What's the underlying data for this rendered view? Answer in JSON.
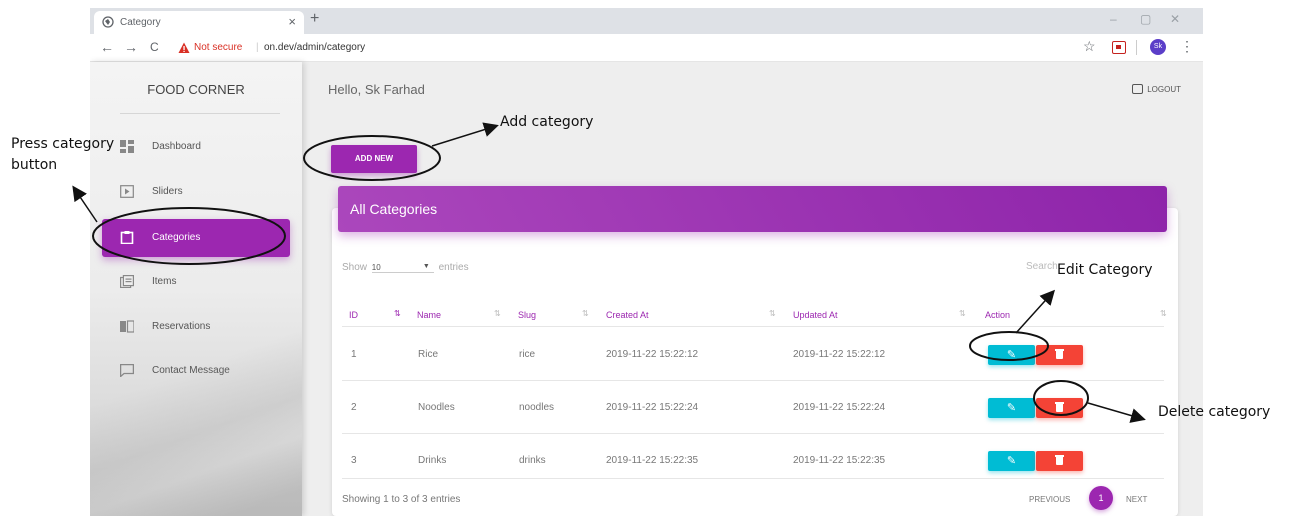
{
  "browser": {
    "tab_title": "Category",
    "tab_close": "×",
    "new_tab": "+",
    "not_secure": "Not secure",
    "url": "on.dev/admin/category",
    "back": "←",
    "forward": "→",
    "reload": "C",
    "star": "☆",
    "avatar": "Sk",
    "menu": "⋮",
    "minimize": "–",
    "restore": "▢",
    "close": "✕"
  },
  "sidebar": {
    "brand": "FOOD CORNER",
    "items": [
      {
        "label": "Dashboard",
        "icon": "dashboard-icon"
      },
      {
        "label": "Sliders",
        "icon": "slider-icon"
      },
      {
        "label": "Categories",
        "icon": "clipboard-icon",
        "active": true
      },
      {
        "label": "Items",
        "icon": "library-icon"
      },
      {
        "label": "Reservations",
        "icon": "reservation-icon"
      },
      {
        "label": "Contact Message",
        "icon": "message-icon"
      }
    ]
  },
  "header": {
    "greeting": "Hello, Sk Farhad",
    "logout": "LOGOUT"
  },
  "main": {
    "add_new": "ADD NEW",
    "card_title": "All Categories",
    "show_label": "Show",
    "show_value": "10",
    "entries_label": "entries",
    "search_label": "Search",
    "columns": [
      "ID",
      "Name",
      "Slug",
      "Created At",
      "Updated At",
      "Action"
    ],
    "rows": [
      {
        "id": "1",
        "name": "Rice",
        "slug": "rice",
        "created": "2019-11-22 15:22:12",
        "updated": "2019-11-22 15:22:12"
      },
      {
        "id": "2",
        "name": "Noodles",
        "slug": "noodles",
        "created": "2019-11-22 15:22:24",
        "updated": "2019-11-22 15:22:24"
      },
      {
        "id": "3",
        "name": "Drinks",
        "slug": "drinks",
        "created": "2019-11-22 15:22:35",
        "updated": "2019-11-22 15:22:35"
      }
    ],
    "showing": "Showing 1 to 3 of 3 entries",
    "previous": "PREVIOUS",
    "current_page": "1",
    "next": "NEXT"
  },
  "annotations": {
    "press_category": "Press category",
    "button": "button",
    "add_category": "Add category",
    "edit_category": "Edit Category",
    "delete_category": "Delete category"
  },
  "colors": {
    "accent": "#9c27b0",
    "edit": "#00bcd4",
    "delete": "#f44336"
  }
}
